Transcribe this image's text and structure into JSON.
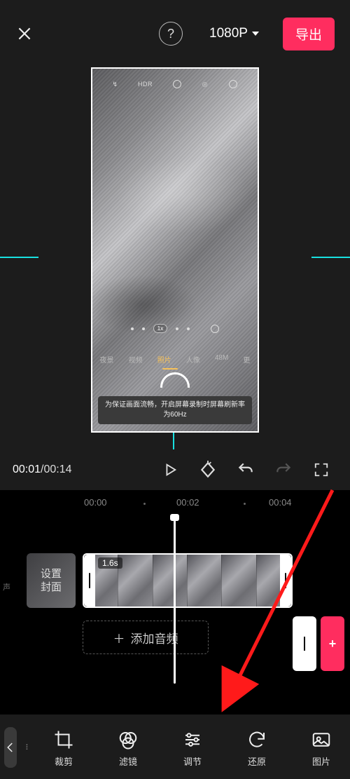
{
  "header": {
    "resolution": "1080P",
    "export_label": "导出"
  },
  "preview": {
    "phone_top_icons": [
      "flash-icon",
      "hdr-label",
      "timer-icon",
      "filter-icon",
      "settings-icon"
    ],
    "hdr_label": "HDR",
    "zoom_chip": "1x",
    "modes": {
      "items": [
        "夜景",
        "视频",
        "照片",
        "人像",
        "48M",
        "更"
      ],
      "selected_index": 2
    },
    "toast_line1": "为保证画面流畅，开启屏幕录制时屏幕刷新率",
    "toast_line2": "为60Hz"
  },
  "playbar": {
    "current": "00:01",
    "total": "00:14"
  },
  "ruler": {
    "marks": [
      "00:00",
      "00:02",
      "00:04"
    ]
  },
  "clip": {
    "cover_label_l1": "设置",
    "cover_label_l2": "封面",
    "duration_chip": "1.6s",
    "add_audio_label": "添加音频",
    "audio_track_hint": "声"
  },
  "toolbar": {
    "items": [
      {
        "name": "crop-tool",
        "label": "裁剪"
      },
      {
        "name": "filter-tool",
        "label": "滤镜"
      },
      {
        "name": "adjust-tool",
        "label": "调节"
      },
      {
        "name": "restore-tool",
        "label": "还原"
      },
      {
        "name": "image-tool",
        "label": "图片"
      }
    ]
  }
}
